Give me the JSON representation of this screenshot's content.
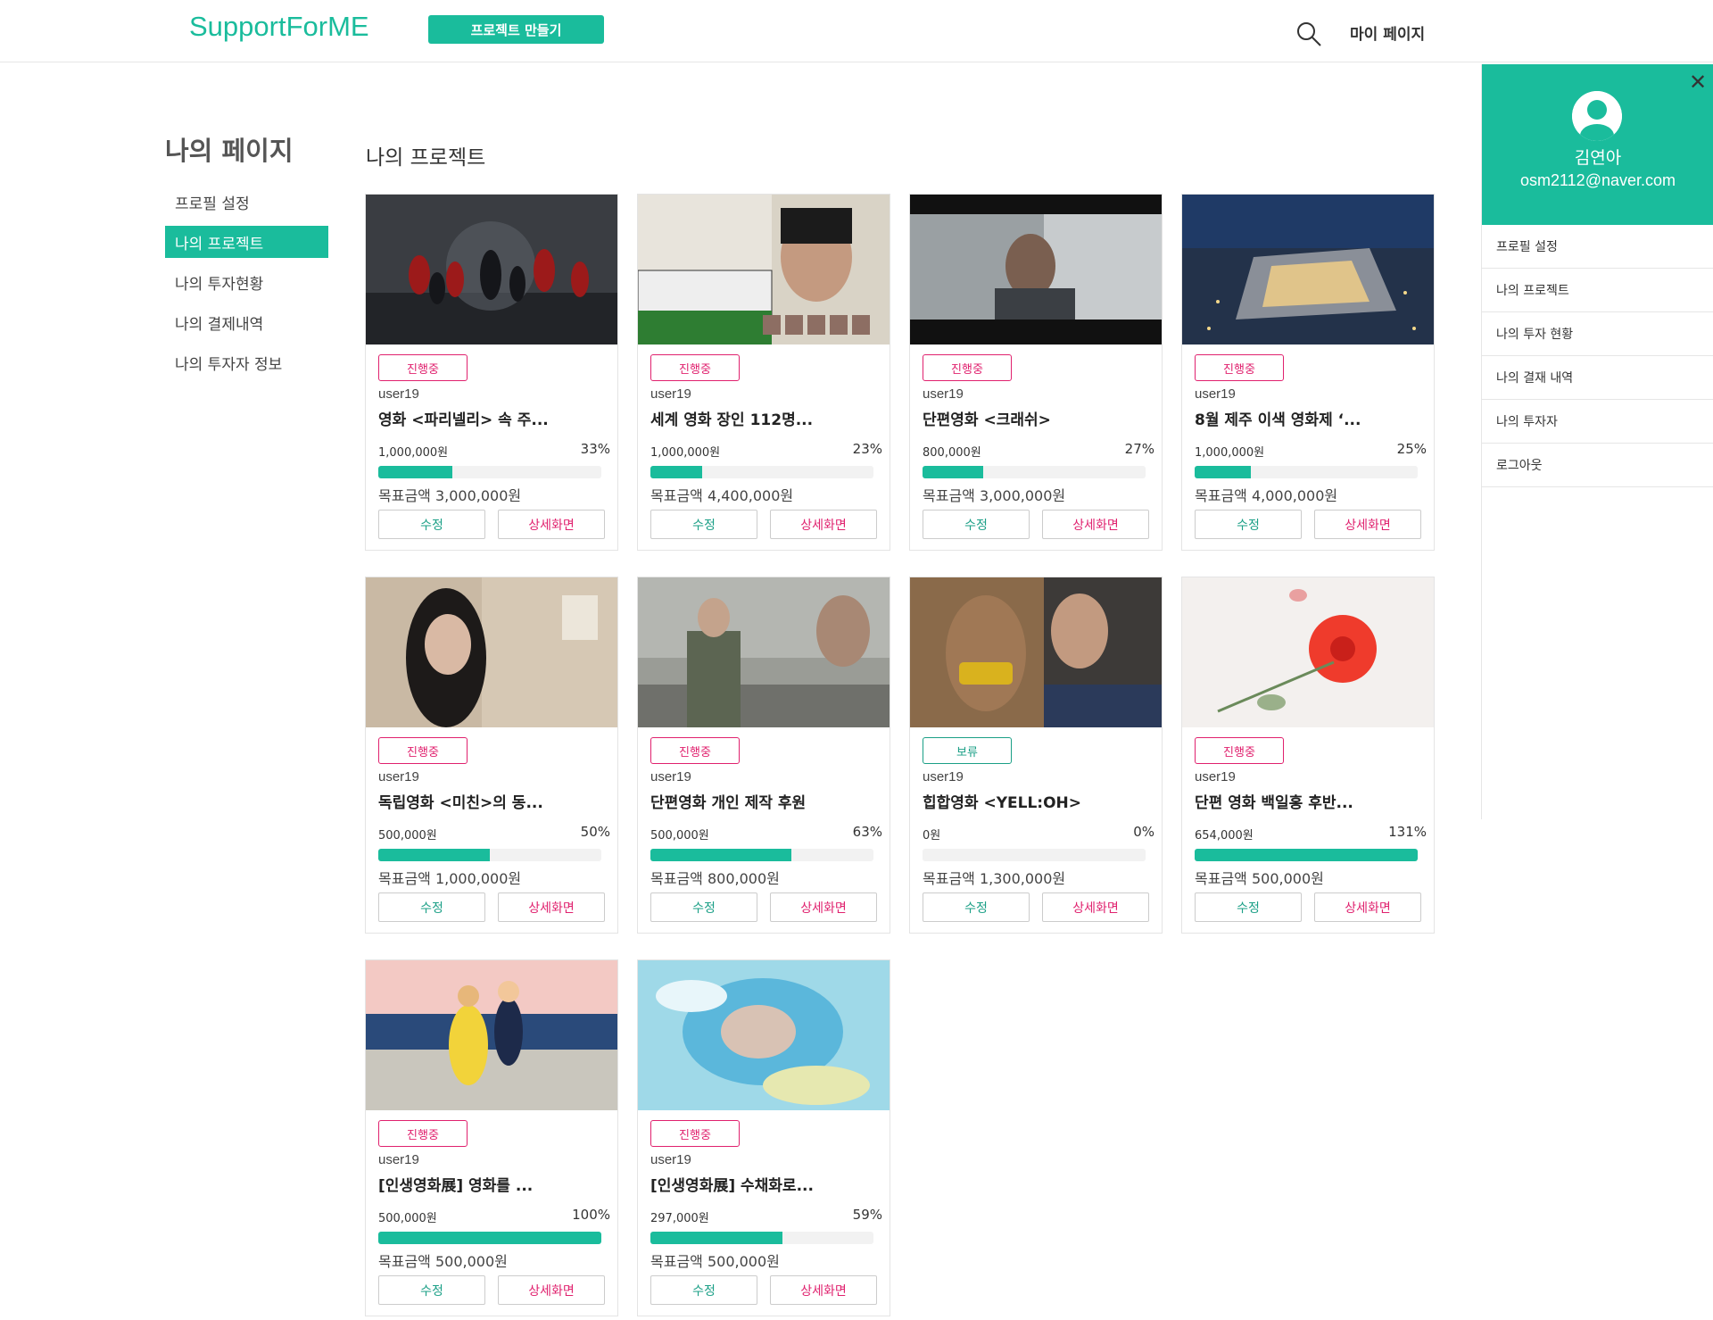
{
  "header": {
    "logo": "SupportForME",
    "create_button": "프로젝트 만들기",
    "mypage_link": "마이 페이지"
  },
  "sidebar": {
    "title": "나의 페이지",
    "items": [
      {
        "label": "프로필 설정"
      },
      {
        "label": "나의 프로젝트"
      },
      {
        "label": "나의 투자현황"
      },
      {
        "label": "나의 결제내역"
      },
      {
        "label": "나의 투자자 정보"
      }
    ]
  },
  "main": {
    "title": "나의 프로젝트",
    "goal_prefix": "목표금액",
    "edit_label": "수정",
    "detail_label": "상세화면",
    "projects": [
      {
        "status": "진행중",
        "author": "user19",
        "title": "영화 <파리넬리> 속 주...",
        "amount": "1,000,000원",
        "percent": "33%",
        "progress": 0.33,
        "goal": "목표금액 3,000,000원"
      },
      {
        "status": "진행중",
        "author": "user19",
        "title": "세계 영화 장인 112명...",
        "amount": "1,000,000원",
        "percent": "23%",
        "progress": 0.23,
        "goal": "목표금액 4,400,000원"
      },
      {
        "status": "진행중",
        "author": "user19",
        "title": "단편영화 <크래쉬>",
        "amount": "800,000원",
        "percent": "27%",
        "progress": 0.27,
        "goal": "목표금액 3,000,000원"
      },
      {
        "status": "진행중",
        "author": "user19",
        "title": "8월 제주 이색 영화제 ‘...",
        "amount": "1,000,000원",
        "percent": "25%",
        "progress": 0.25,
        "goal": "목표금액 4,000,000원"
      },
      {
        "status": "진행중",
        "author": "user19",
        "title": "독립영화 <미친>의 동...",
        "amount": "500,000원",
        "percent": "50%",
        "progress": 0.5,
        "goal": "목표금액 1,000,000원"
      },
      {
        "status": "진행중",
        "author": "user19",
        "title": "단편영화 개인 제작 후원",
        "amount": "500,000원",
        "percent": "63%",
        "progress": 0.63,
        "goal": "목표금액 800,000원"
      },
      {
        "status": "보류",
        "author": "user19",
        "title": "힙합영화 <YELL:OH>",
        "amount": "0원",
        "percent": "0%",
        "progress": 0,
        "goal": "목표금액 1,300,000원"
      },
      {
        "status": "진행중",
        "author": "user19",
        "title": "단편 영화 백일홍 후반...",
        "amount": "654,000원",
        "percent": "131%",
        "progress": 1.0,
        "goal": "목표금액 500,000원"
      },
      {
        "status": "진행중",
        "author": "user19",
        "title": "[인생영화展] 영화를 ...",
        "amount": "500,000원",
        "percent": "100%",
        "progress": 1.0,
        "goal": "목표금액 500,000원"
      },
      {
        "status": "진행중",
        "author": "user19",
        "title": "[인생영화展] 수채화로...",
        "amount": "297,000원",
        "percent": "59%",
        "progress": 0.59,
        "goal": "목표금액 500,000원"
      }
    ]
  },
  "user_panel": {
    "name": "김연아",
    "email": "osm2112@naver.com",
    "close_label": "✕",
    "items": [
      {
        "label": "프로필 설정"
      },
      {
        "label": "나의 프로젝트"
      },
      {
        "label": "나의 투자 현황"
      },
      {
        "label": "나의 결재 내역"
      },
      {
        "label": "나의 투자자"
      },
      {
        "label": "로그아웃"
      }
    ]
  },
  "colors": {
    "accent": "#1abc9c",
    "ongoing": "#e0216e",
    "hold": "#1a9f86"
  },
  "icons": [
    "search-icon",
    "close-icon",
    "avatar-icon"
  ]
}
